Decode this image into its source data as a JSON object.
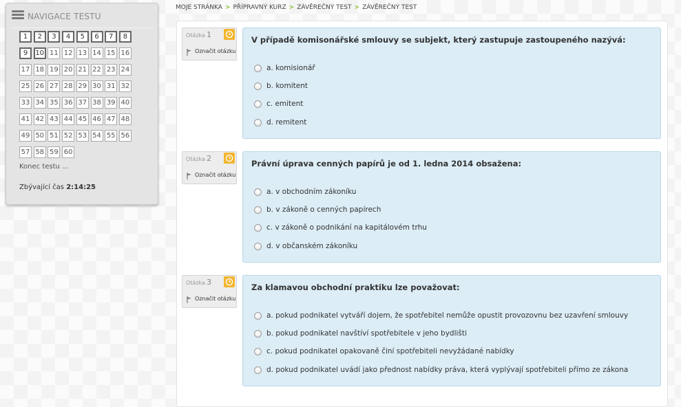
{
  "navigation": {
    "title": "NAVIGACE TESTU",
    "questions": [
      "1",
      "2",
      "3",
      "4",
      "5",
      "6",
      "7",
      "8",
      "9",
      "10",
      "11",
      "12",
      "13",
      "14",
      "15",
      "16",
      "17",
      "18",
      "19",
      "20",
      "21",
      "22",
      "23",
      "24",
      "25",
      "26",
      "27",
      "28",
      "29",
      "30",
      "31",
      "32",
      "33",
      "34",
      "35",
      "36",
      "37",
      "38",
      "39",
      "40",
      "41",
      "42",
      "43",
      "44",
      "45",
      "46",
      "47",
      "48",
      "49",
      "50",
      "51",
      "52",
      "53",
      "54",
      "55",
      "56",
      "57",
      "58",
      "59",
      "60"
    ],
    "answered": [
      "1",
      "2",
      "3",
      "4",
      "5",
      "6",
      "7",
      "8",
      "9",
      "10"
    ],
    "finish_link": "Konec testu ...",
    "timer_label": "Zbývající čas",
    "timer_value": "2:14:25"
  },
  "breadcrumb": [
    "MOJE STRÁNKA",
    "PŘÍPRAVNÝ KURZ",
    "ZÁVĚREČNÝ TEST",
    "ZÁVĚREČNÝ TEST"
  ],
  "icons": {
    "menu": "hamburger-icon",
    "timer": "clock-icon",
    "flag": "flag-icon",
    "separator": "chevron-right-icon"
  },
  "colors": {
    "question_bg": "#dcedf6",
    "clock": "#f3b52e",
    "breadcrumb_sep": "#8bbd3a"
  },
  "questions": [
    {
      "label": "Otázka",
      "number": "1",
      "flag_label": "Označit otázku",
      "text": "V případě komisonářské smlouvy se subjekt, který zastupuje zastoupeného nazývá:",
      "answers": [
        "a. komisionář",
        "b. komitent",
        "c. emitent",
        "d. remitent"
      ]
    },
    {
      "label": "Otázka",
      "number": "2",
      "flag_label": "Označit otázku",
      "text": "Právní úprava cenných papírů je od 1. ledna 2014 obsažena:",
      "answers": [
        "a. v obchodním zákoníku",
        "b. v zákoně o cenných papírech",
        "c. v zákoně o podnikání na kapitálovém trhu",
        "d. v občanském zákoníku"
      ]
    },
    {
      "label": "Otázka",
      "number": "3",
      "flag_label": "Označit otázku",
      "text": "Za klamavou obchodní praktiku lze považovat:",
      "answers": [
        "a. pokud podnikatel vytváří dojem, že spotřebitel nemůže opustit provozovnu bez uzavření smlouvy",
        "b. pokud podnikatel navštíví spotřebitele v jeho bydlišti",
        "c. pokud podnikatel opakovaně činí spotřebiteli nevyžádané nabídky",
        "d. pokud podnikatel uvádí jako přednost nabídky práva, která vyplývají spotřebiteli přímo ze zákona"
      ]
    }
  ]
}
